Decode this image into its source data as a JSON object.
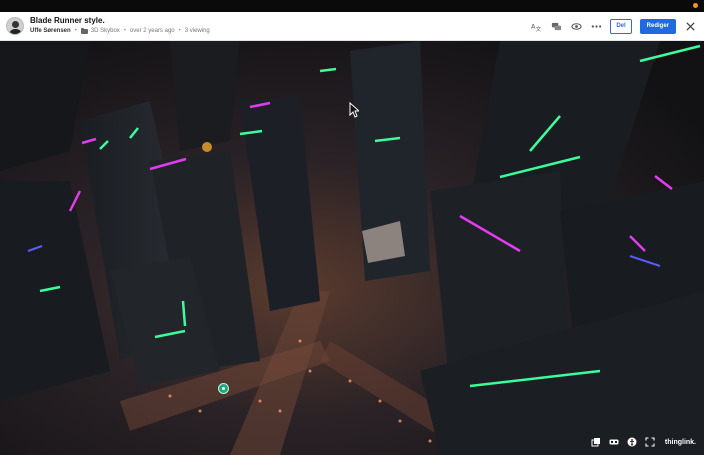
{
  "header": {
    "title": "Blade Runner style.",
    "author": "Uffe Sørensen",
    "folder": "3D Skybox",
    "date": "over 2 years ago",
    "views": "3 viewing",
    "share_label": "Del",
    "edit_label": "Rediger"
  },
  "toolbar_icons": [
    "translate-icon",
    "comments-icon",
    "eye-icon",
    "more-icon",
    "close-icon"
  ],
  "viewer_controls": [
    "layers-icon",
    "vr-icon",
    "accessibility-icon",
    "fullscreen-icon"
  ],
  "brand": "thinglink.",
  "colors": {
    "accent": "#1f6ae0",
    "neon_green": "#3dfc9a",
    "neon_magenta": "#e23cf0",
    "hotspot": "#1ea97c"
  }
}
